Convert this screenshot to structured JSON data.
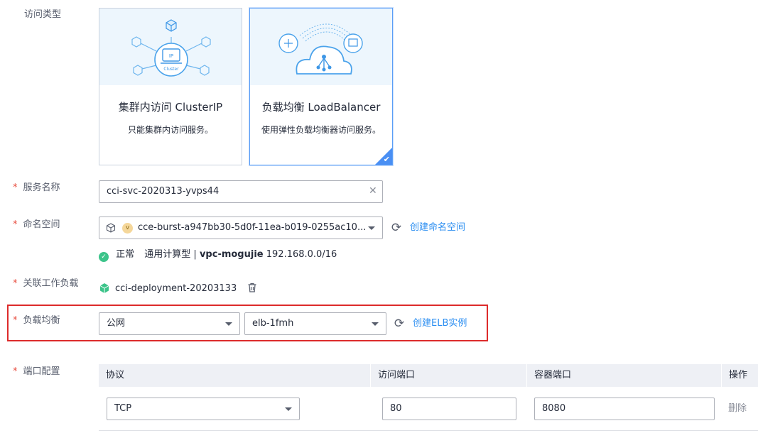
{
  "access_type": {
    "label": "访问类型",
    "cards": [
      {
        "title": "集群内访问 ClusterIP",
        "desc": "只能集群内访问服务。",
        "icon_text": "IP",
        "icon_sub": "Cluster",
        "selected": false
      },
      {
        "title": "负载均衡 LoadBalancer",
        "desc": "使用弹性负载均衡器访问服务。",
        "selected": true
      }
    ]
  },
  "service_name": {
    "required": "*",
    "label": "服务名称",
    "value": "cci-svc-2020313-yvps44",
    "clear_icon": "close-icon"
  },
  "namespace": {
    "required": "*",
    "label": "命名空间",
    "value": "cce-burst-a947bb30-5d0f-11ea-b019-0255ac10...",
    "badge": "v",
    "create_link": "创建命名空间",
    "status_text": "正常",
    "type_text": "通用计算型 |",
    "vpc_name": "vpc-mogujie",
    "cidr": "192.168.0.0/16",
    "status_color": "#3cc48a"
  },
  "workload": {
    "required": "*",
    "label": "关联工作负载",
    "value": "cci-deployment-20203133"
  },
  "load_balancer": {
    "required": "*",
    "label": "负载均衡",
    "network_value": "公网",
    "elb_value": "elb-1fmh",
    "create_link": "创建ELB实例"
  },
  "ports": {
    "required": "*",
    "label": "端口配置",
    "headers": [
      "协议",
      "访问端口",
      "容器端口",
      "操作"
    ],
    "rows": [
      {
        "protocol": "TCP",
        "access_port": "80",
        "container_port": "8080",
        "action": "删除"
      }
    ]
  },
  "colors": {
    "accent": "#2b8ef1",
    "highlight_border": "#dd2b2b",
    "selected_card": "#4a8ff3"
  }
}
